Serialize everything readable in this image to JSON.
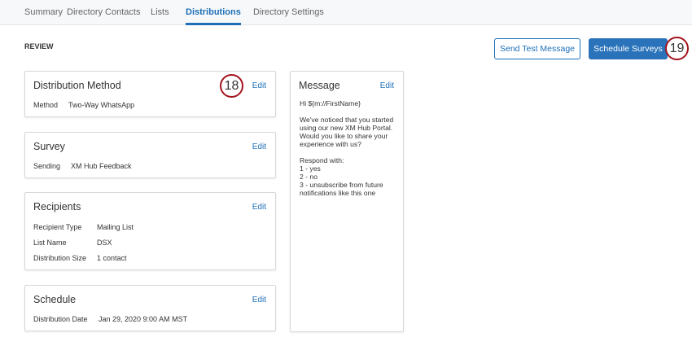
{
  "tabs": [
    "Summary",
    "Directory Contacts",
    "Lists",
    "Distributions",
    "Directory Settings"
  ],
  "review_label": "REVIEW",
  "buttons": {
    "send_test": "Send Test Message",
    "schedule": "Schedule Surveys"
  },
  "callouts": {
    "a": "18",
    "b": "19"
  },
  "edit_label": "Edit",
  "distribution_method": {
    "title": "Distribution Method",
    "label": "Method",
    "value": "Two-Way WhatsApp"
  },
  "survey": {
    "title": "Survey",
    "label": "Sending",
    "value": "XM Hub Feedback"
  },
  "recipients": {
    "title": "Recipients",
    "rows": [
      {
        "label": "Recipient Type",
        "value": "Mailing List"
      },
      {
        "label": "List Name",
        "value": "DSX"
      },
      {
        "label": "Distribution Size",
        "value": "1 contact"
      }
    ]
  },
  "schedule": {
    "title": "Schedule",
    "label": "Distribution Date",
    "value": "Jan 29, 2020 9:00 AM MST"
  },
  "message": {
    "title": "Message",
    "greeting": "Hi ${m://FirstName}",
    "body": "We've noticed that you started using our new XM Hub Portal. Would you like to share your experience with us?",
    "respond": "Respond with:",
    "options": [
      "1 - yes",
      "2 - no",
      "3 - unsubscribe from future notifications like this one"
    ]
  }
}
